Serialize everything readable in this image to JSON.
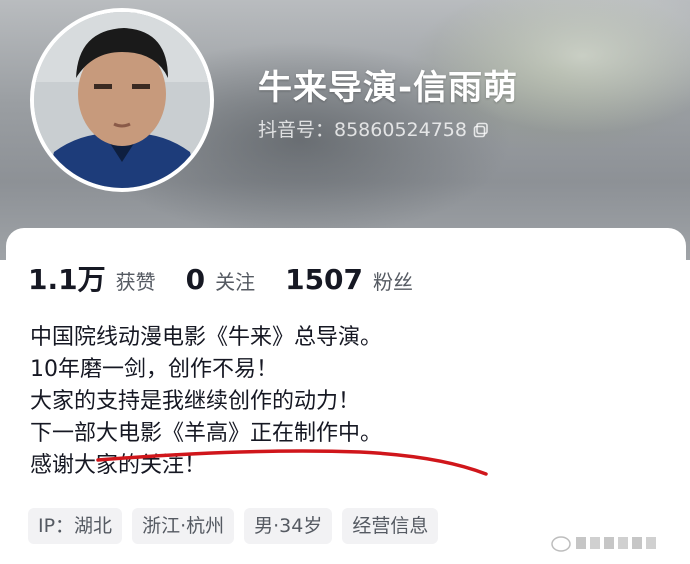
{
  "profile": {
    "name": "牛来导演-信雨萌",
    "douyin_id": "抖音号：85860524758"
  },
  "stats": [
    {
      "value": "1.1万",
      "label": "获赞"
    },
    {
      "value": "0",
      "label": "关注"
    },
    {
      "value": "1507",
      "label": "粉丝"
    }
  ],
  "bio": [
    "中国院线动漫电影《牛来》总导演。",
    "10年磨一剑，创作不易！",
    "大家的支持是我继续创作的动力！",
    "下一部大电影《羊高》正在制作中。",
    "感谢大家的关注！"
  ],
  "tags": [
    "IP：湖北",
    "浙江·杭州",
    "男·34岁",
    "经营信息"
  ],
  "icons": {
    "copy": "copy-icon",
    "watermark": "weibo-watermark-icon"
  },
  "colors": {
    "annotation": "#d0161b",
    "text": "#161823",
    "muted": "#555a62"
  }
}
